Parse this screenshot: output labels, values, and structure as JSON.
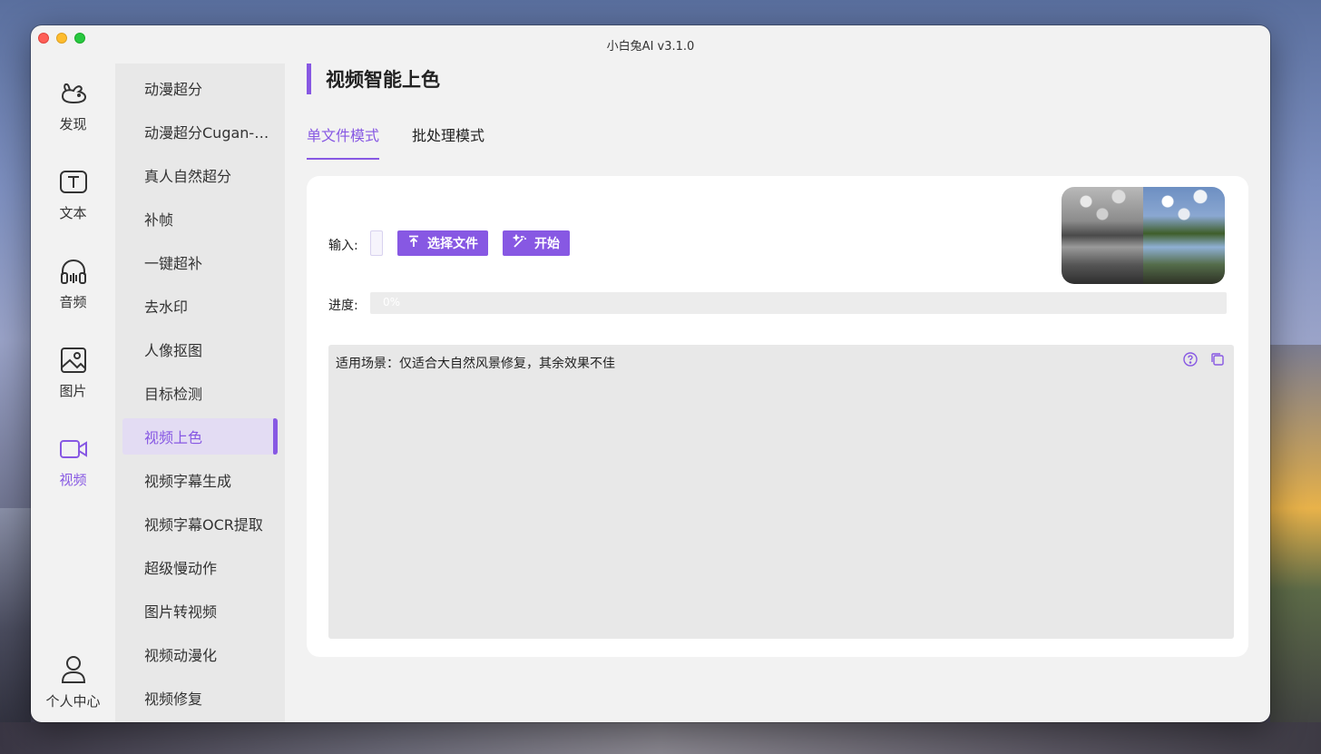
{
  "window": {
    "title": "小白兔AI v3.1.0"
  },
  "nav": {
    "items": [
      {
        "label": "发现",
        "icon": "rabbit-icon"
      },
      {
        "label": "文本",
        "icon": "text-icon"
      },
      {
        "label": "音频",
        "icon": "headphones-icon"
      },
      {
        "label": "图片",
        "icon": "image-icon"
      },
      {
        "label": "视频",
        "icon": "video-camera-icon",
        "active": true
      }
    ],
    "profile": {
      "label": "个人中心",
      "icon": "user-icon"
    }
  },
  "submenu": {
    "items": [
      "动漫超分",
      "动漫超分Cugan-…",
      "真人自然超分",
      "补帧",
      "一键超补",
      "去水印",
      "人像抠图",
      "目标检测",
      "视频上色",
      "视频字幕生成",
      "视频字幕OCR提取",
      "超级慢动作",
      "图片转视频",
      "视频动漫化",
      "视频修复"
    ],
    "active_index": 8
  },
  "main": {
    "title": "视频智能上色",
    "tabs": [
      {
        "label": "单文件模式",
        "active": true
      },
      {
        "label": "批处理模式",
        "active": false
      }
    ],
    "input_label": "输入:",
    "select_file_label": "选择文件",
    "start_label": "开始",
    "progress_label": "进度:",
    "progress_text": "0%",
    "progress_value": 0,
    "description": "适用场景：仅适合大自然风景修复，其余效果不佳",
    "help_icon": "help-circle-icon",
    "copy_icon": "copy-icon"
  },
  "colors": {
    "accent": "#8758e3",
    "window_bg": "#f2f2f2",
    "submenu_bg": "#e8e8e8",
    "active_item_bg": "#e3dcf3"
  }
}
